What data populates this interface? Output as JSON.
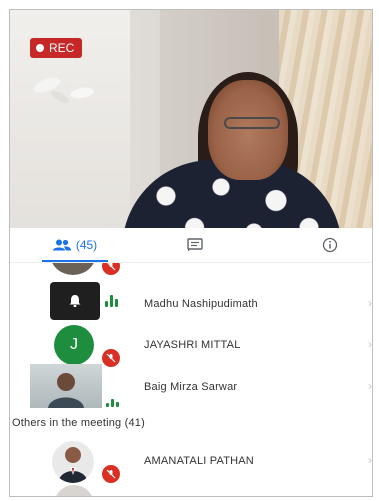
{
  "video": {
    "rec_label": "REC"
  },
  "tabs": {
    "people_count": "(45)"
  },
  "participants": [
    {
      "name": "Madhu Nashipudimath"
    },
    {
      "name": "JAYASHRI MITTAL",
      "avatar_letter": "J"
    },
    {
      "name": "Baig Mirza Sarwar"
    }
  ],
  "others_section": {
    "title": "Others in the meeting (41)"
  },
  "others": [
    {
      "name": "AMANATALI PATHAN"
    }
  ],
  "colors": {
    "accent": "#1a73e8",
    "rec": "#c62828",
    "mic_off": "#d93025",
    "speaking": "#1e8e3e",
    "avatar_j": "#1e8e3e"
  }
}
